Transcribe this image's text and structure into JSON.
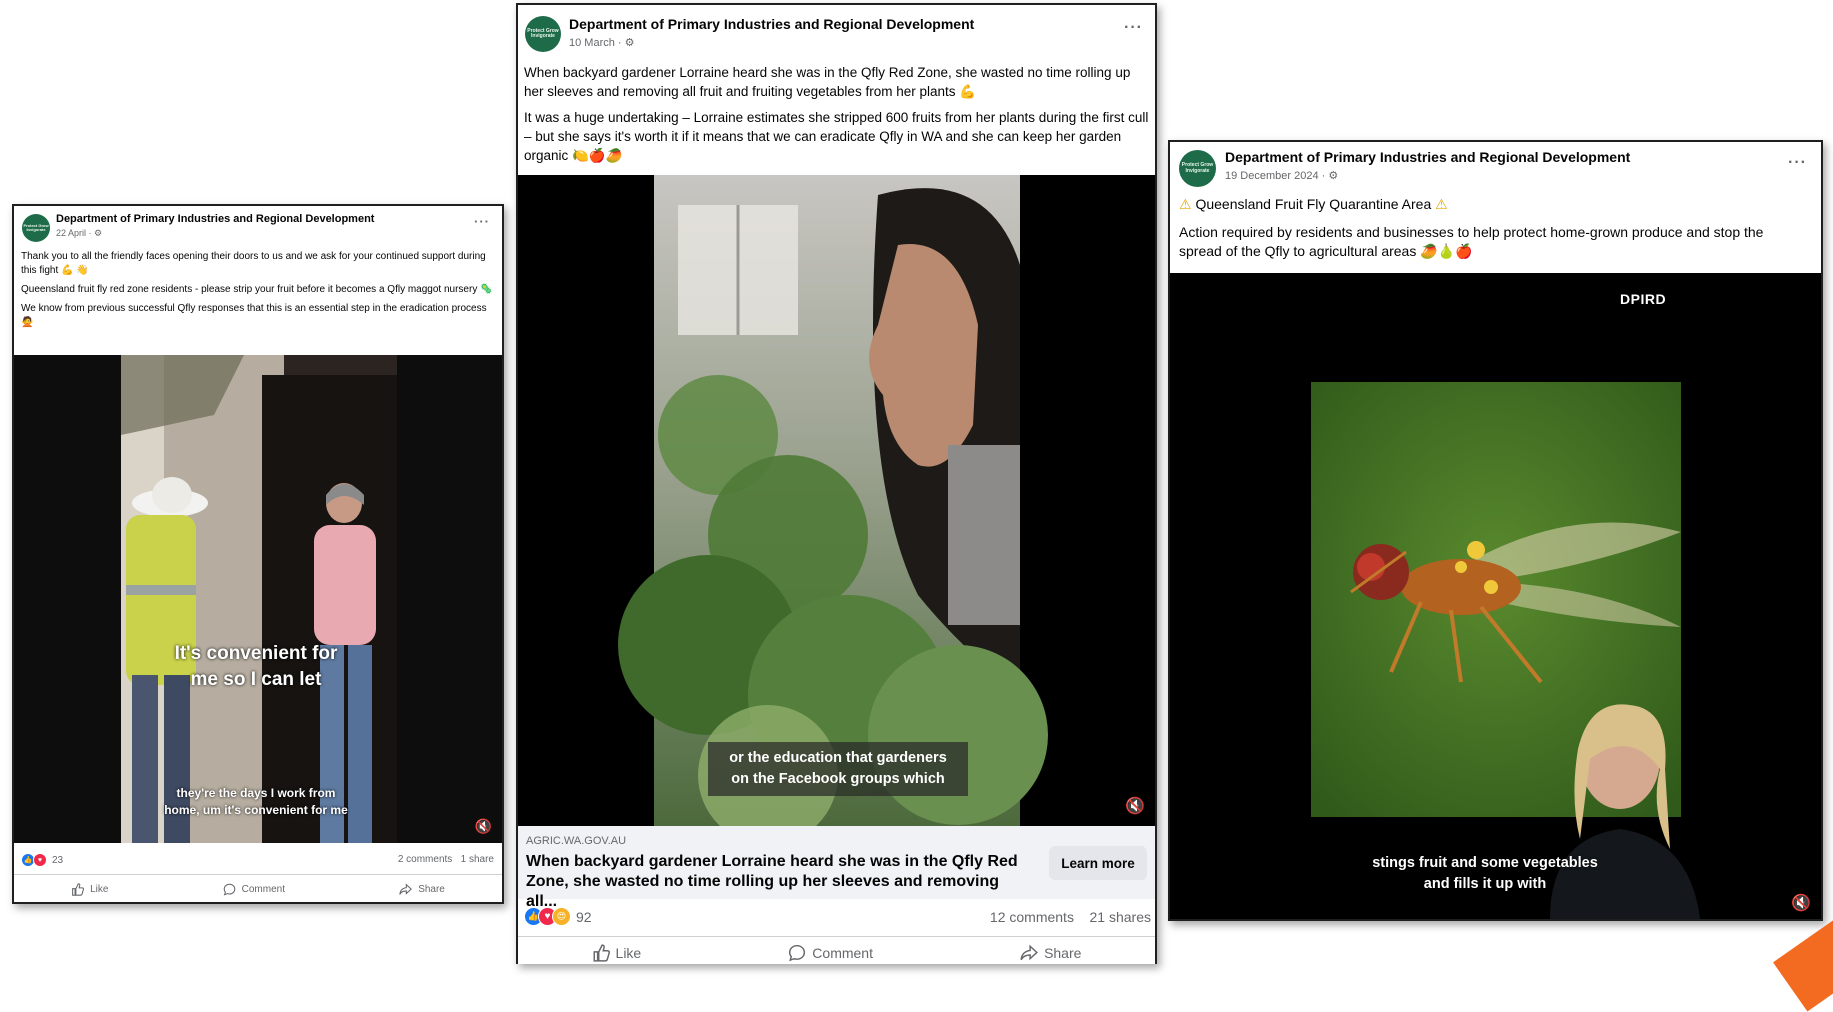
{
  "post1": {
    "avatar_text": "Protect Grow Invigorate",
    "author": "Department of Primary Industries and Regional Development",
    "meta": "22 April ·",
    "paragraphs": [
      "Thank you to all the friendly faces opening their doors to us and we ask for your continued support during this fight 💪 👋",
      "Queensland fruit fly red zone residents - please strip your fruit before it becomes a Qfly maggot nursery 🦠",
      "We know from previous successful Qfly responses that this is an essential step in the eradication process 🙅"
    ],
    "caption_main": "It's convenient for me so I can let",
    "caption_sub": "they're the days I work from home, um it's convenient for me",
    "reaction_count": "23",
    "comments": "2 comments",
    "shares": "1 share",
    "actions": {
      "like": "Like",
      "comment": "Comment",
      "share": "Share"
    }
  },
  "post2": {
    "avatar_text": "Protect Grow Invigorate",
    "author": "Department of Primary Industries and Regional Development",
    "meta": "10 March ·",
    "paragraphs": [
      "When backyard gardener Lorraine heard she was in the Qfly Red Zone, she wasted no time rolling up her sleeves and removing all fruit and fruiting vegetables from her plants 💪",
      "It was a huge undertaking – Lorraine estimates she stripped 600 fruits from her plants during the first cull – but she says it's worth it if it means that we can eradicate Qfly in WA and she can keep her garden organic 🍋🍎🥭"
    ],
    "caption": "or the education that gardeners on the Facebook groups which",
    "link_domain": "AGRIC.WA.GOV.AU",
    "link_title": "When backyard gardener Lorraine heard she was in the Qfly Red Zone, she wasted no time rolling up her sleeves and removing all...",
    "learn_more": "Learn more",
    "reaction_count": "92",
    "comments": "12 comments",
    "shares": "21 shares",
    "actions": {
      "like": "Like",
      "comment": "Comment",
      "share": "Share"
    }
  },
  "post3": {
    "avatar_text": "Protect Grow Invigorate",
    "author": "Department of Primary Industries and Regional Development",
    "meta": "19 December 2024 ·",
    "headline": "Queensland Fruit Fly Quarantine Area",
    "paragraph": "Action required by residents and businesses to help protect home-grown produce and stop the spread of the Qfly to agricultural areas 🥭🍐🍎",
    "logo": "DPIRD",
    "caption": "stings fruit and some vegetables and fills it up with"
  },
  "colors": {
    "facebook_blue": "#1877f2",
    "brand_green": "#1e6b4a",
    "brand_orange": "#f26b21"
  }
}
